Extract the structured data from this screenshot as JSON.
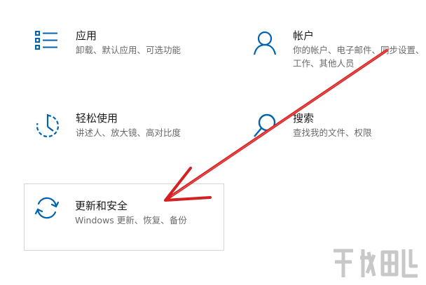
{
  "settings_tiles": [
    {
      "id": "apps",
      "title": "应用",
      "desc": "卸载、默认应用、可选功能",
      "icon": "apps-list-icon"
    },
    {
      "id": "account",
      "title": "帐户",
      "desc": "你的帐户、电子邮件、同步设置、工作、其他人员",
      "icon": "person-icon"
    },
    {
      "id": "ease",
      "title": "轻松使用",
      "desc": "讲述人、放大镜、高对比度",
      "icon": "ease-of-access-icon"
    },
    {
      "id": "search",
      "title": "搜索",
      "desc": "查找我的文件、权限",
      "icon": "search-icon"
    },
    {
      "id": "update",
      "title": "更新和安全",
      "desc": "Windows 更新、恢复、备份",
      "icon": "sync-icon"
    }
  ],
  "colors": {
    "accent": "#0063b1",
    "arrow": "#d42020"
  }
}
